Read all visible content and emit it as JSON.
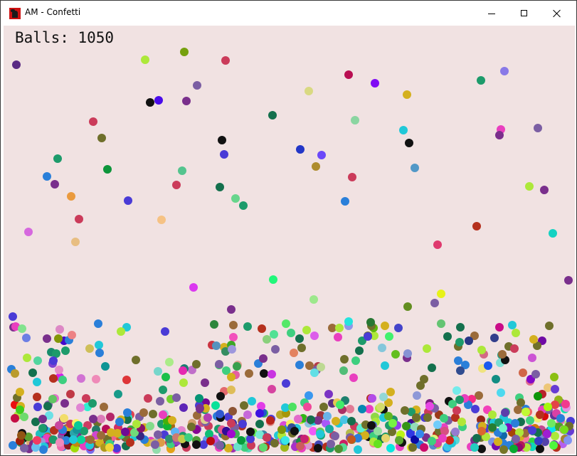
{
  "window": {
    "title": "AM - Confetti",
    "app_icon": "app-icon",
    "controls": [
      "minimize-icon",
      "maximize-icon",
      "close-icon"
    ]
  },
  "hud": {
    "label": "Balls: 1050"
  },
  "scene": {
    "background": "#f1e2e2",
    "ball_palette": [
      "#e93fbf",
      "#2a7fd9",
      "#ade83a",
      "#1d9b6b",
      "#7a2f8c",
      "#d4b01e",
      "#111111",
      "#b5301d",
      "#6f6f2b",
      "#21c8d8",
      "#9b6b3a",
      "#4a3bd6",
      "#3ecf7f",
      "#7b5ea3",
      "#cb3b5a",
      "#14704d"
    ]
  }
}
